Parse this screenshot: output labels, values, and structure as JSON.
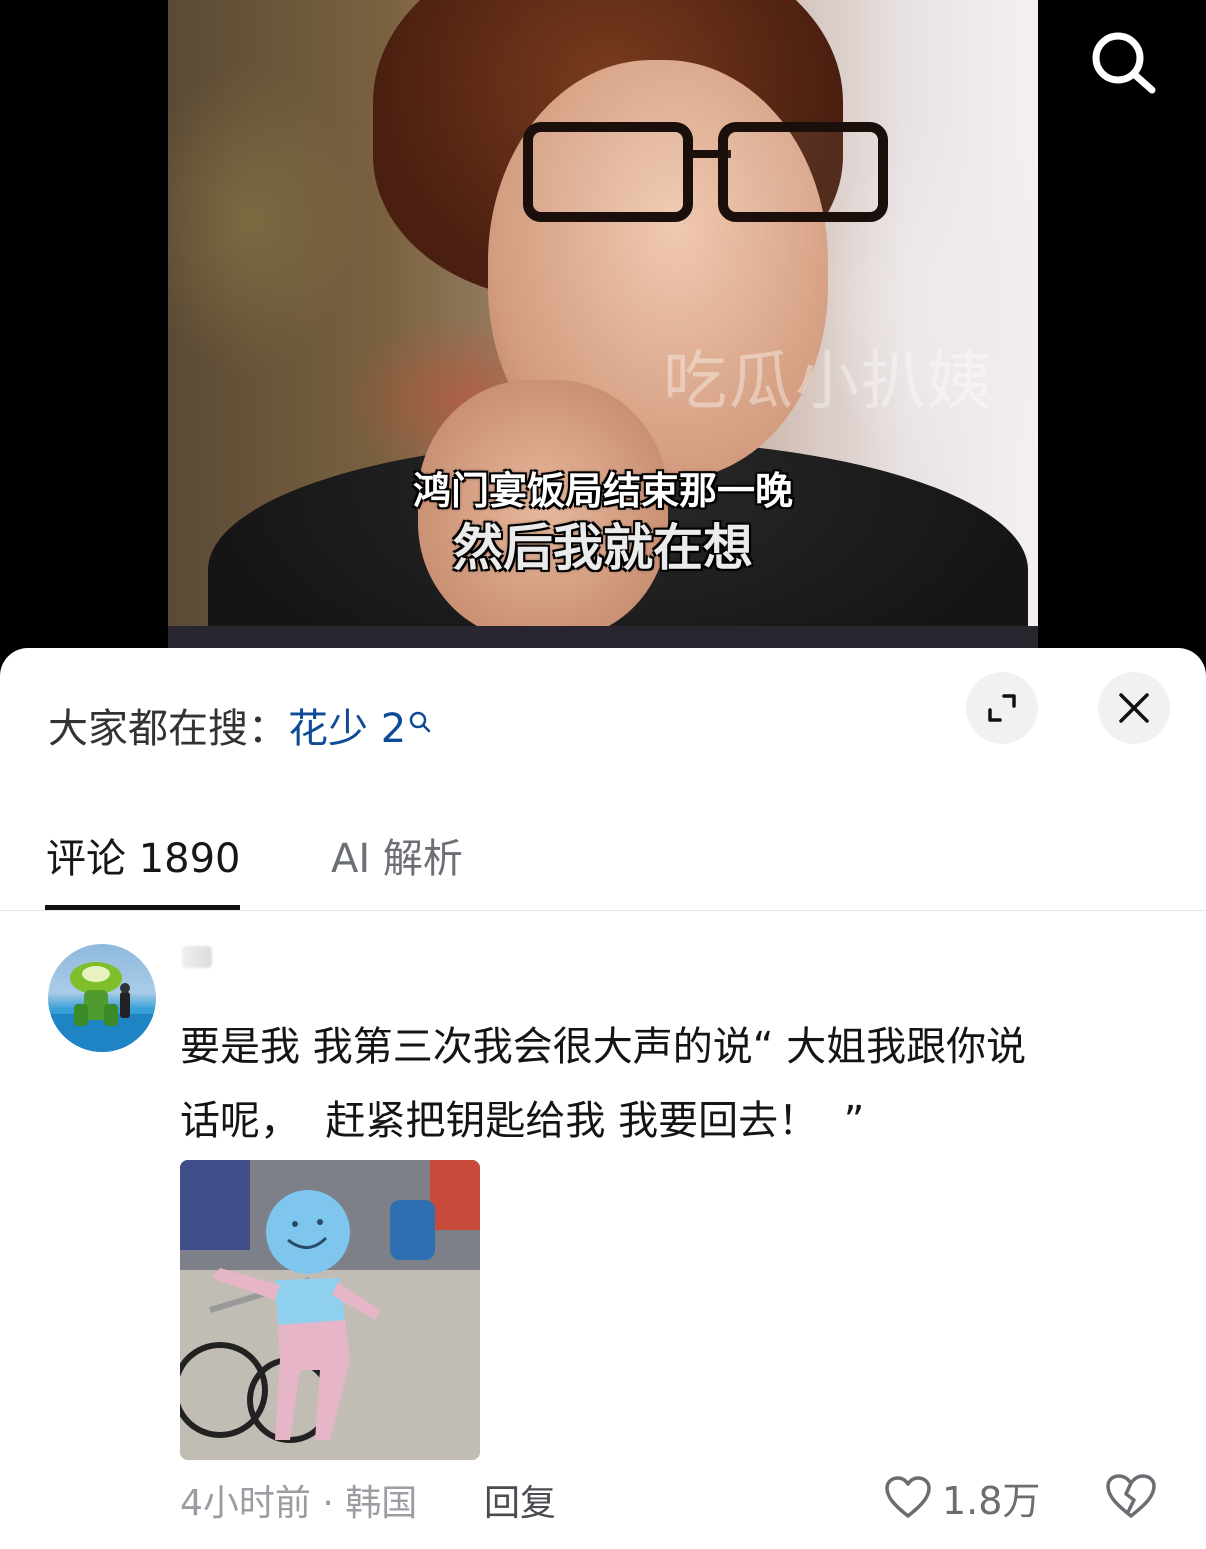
{
  "video": {
    "watermark": "吃瓜小扒姨",
    "subtitle_line1": "鸿门宴饭局结束那一晚",
    "subtitle_line2": "然后我就在想"
  },
  "header": {
    "hot_search_prefix": "大家都在搜：",
    "hot_search_term": "花少 2"
  },
  "tabs": [
    {
      "label": "评论 1890",
      "active": true
    },
    {
      "label": "AI 解析",
      "active": false
    }
  ],
  "comment": {
    "text": "要是我 我第三次我会很大声的说“ 大姐我跟你说\n话呢，  赶紧把钥匙给我 我要回去！  ”",
    "time_location": "4小时前 · 韩国",
    "reply_label": "回复",
    "like_count": "1.8万"
  },
  "colors": {
    "link_blue": "#0f4a96",
    "sheet_bg": "#ffffff",
    "muted_text": "#9b9da2"
  },
  "icons": [
    "search-icon",
    "search-small-icon",
    "expand-icon",
    "close-icon",
    "heart-icon",
    "broken-heart-icon"
  ]
}
